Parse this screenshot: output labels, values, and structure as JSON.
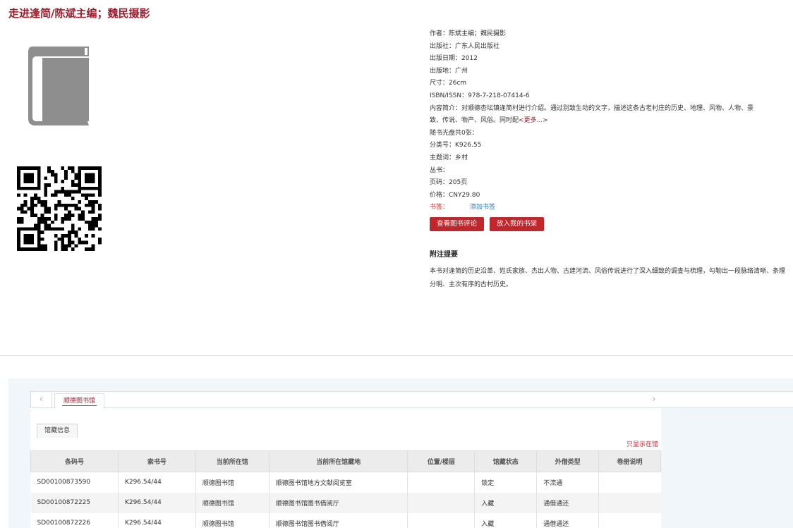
{
  "book": {
    "title": "走进逢简/陈斌主编；魏民摄影"
  },
  "metadata": [
    {
      "label": "作者：",
      "value": "陈斌主编；魏民摄影"
    },
    {
      "label": "出版社：",
      "value": "广东人民出版社"
    },
    {
      "label": "出版日期：",
      "value": "2012"
    },
    {
      "label": "出版地：",
      "value": "广州"
    },
    {
      "label": "尺寸：",
      "value": "26cm"
    },
    {
      "label": "ISBN/ISSN：",
      "value": "978-7-218-07414-6"
    }
  ],
  "summary": {
    "label": "内容简介：",
    "value": "对顺德杏坛镇逢简村进行介绍。通过别致生动的文字，描述这条古老村庄的历史、地理、风物、人物、景致、传说、物产、风俗。同时配",
    "more": "<更多...>"
  },
  "metadata2": [
    {
      "label": "随书光盘共0张：",
      "value": ""
    },
    {
      "label": "分类号：",
      "value": "K926.55"
    },
    {
      "label": "主题词：",
      "value": "乡村"
    },
    {
      "label": "丛书：",
      "value": ""
    },
    {
      "label": "页码：",
      "value": "205页"
    },
    {
      "label": "价格：",
      "value": "CNY29.80"
    }
  ],
  "bookmark": {
    "label": "书签：",
    "link": "添加书签"
  },
  "buttons": {
    "review": "查看图书评论",
    "shelf": "放入我的书架"
  },
  "notes": {
    "title": "附注提要",
    "text": "本书对逢简的历史沿革、姓氏家族、杰出人物、古建河流、风俗传说进行了深入细致的调查与梳理，勾勒出一段脉络清晰、条理分明、主次有序的古村历史。"
  },
  "library_tabs": {
    "active": "顺德图书馆",
    "prev_icon": "‹",
    "next_icon": "›"
  },
  "holdings": {
    "subtab": "馆藏信息",
    "filter": "只显示在馆",
    "columns": [
      "条码号",
      "索书号",
      "当前所在馆",
      "当前所在馆藏地",
      "位置/楼层",
      "馆藏状态",
      "外借类型",
      "卷册说明"
    ],
    "rows": [
      [
        "SD00100873590",
        "K296.54/44",
        "顺德图书馆",
        "顺德图书馆地方文献阅览室",
        "",
        "锁定",
        "不流通",
        ""
      ],
      [
        "SD00100872225",
        "K296.54/44",
        "顺德图书馆",
        "顺德图书馆图书借阅厅",
        "",
        "入藏",
        "通借通还",
        ""
      ],
      [
        "SD00100872226",
        "K296.54/44",
        "顺德图书馆",
        "顺德图书馆图书借阅厅",
        "",
        "入藏",
        "通借通还",
        ""
      ]
    ]
  }
}
